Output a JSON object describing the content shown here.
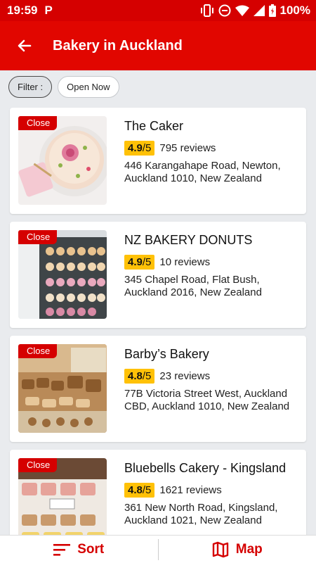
{
  "status": {
    "time": "19:59",
    "battery": "100%"
  },
  "appbar": {
    "title": "Bakery in Auckland"
  },
  "filters": {
    "label": "Filter :",
    "open_now": "Open Now"
  },
  "listings": [
    {
      "badge": "Close",
      "name": "The Caker",
      "rating": "4.9",
      "rating_max": "/5",
      "reviews": "795 reviews",
      "address_line1": "446 Karangahape Road, Newton,",
      "address_line2": "Auckland 1010, New Zealand"
    },
    {
      "badge": "Close",
      "name": "NZ BAKERY DONUTS",
      "rating": "4.9",
      "rating_max": "/5",
      "reviews": "10 reviews",
      "address_line1": "345 Chapel Road, Flat Bush,",
      "address_line2": "Auckland 2016, New Zealand"
    },
    {
      "badge": "Close",
      "name": "Barby’s Bakery",
      "rating": "4.8",
      "rating_max": "/5",
      "reviews": "23 reviews",
      "address_line1": "77B Victoria Street West, Auckland",
      "address_line2": "CBD, Auckland 1010, New Zealand"
    },
    {
      "badge": "Close",
      "name": "Bluebells Cakery - Kingsland",
      "rating": "4.8",
      "rating_max": "/5",
      "reviews": "1621 reviews",
      "address_line1": "361 New North Road, Kingsland,",
      "address_line2": "Auckland 1021, New Zealand"
    }
  ],
  "bottombar": {
    "sort": "Sort",
    "map": "Map"
  },
  "colors": {
    "primary": "#e10600",
    "badge": "#d50000",
    "rating_bg": "#ffc107"
  }
}
